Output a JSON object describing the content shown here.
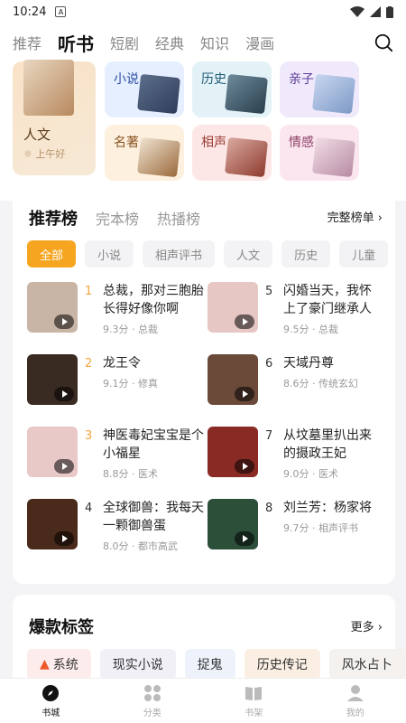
{
  "status": {
    "time": "10:24"
  },
  "topnav": {
    "tabs": [
      "推荐",
      "听书",
      "短剧",
      "经典",
      "知识",
      "漫画"
    ]
  },
  "feature": {
    "title": "人文",
    "subtitle": "上午好"
  },
  "categories": [
    {
      "label": "小说"
    },
    {
      "label": "历史"
    },
    {
      "label": "亲子"
    },
    {
      "label": "名著"
    },
    {
      "label": "相声"
    },
    {
      "label": "情感"
    }
  ],
  "ranking": {
    "tabs": [
      "推荐榜",
      "完本榜",
      "热播榜"
    ],
    "full_link": "完整榜单 ›",
    "filters": [
      "全部",
      "小说",
      "相声评书",
      "人文",
      "历史",
      "儿童"
    ],
    "items": [
      {
        "rank": "1",
        "title": "总裁，那对三胞胎长得好像你啊",
        "meta": "9.3分 · 总裁",
        "cover": "#c9b5a6"
      },
      {
        "rank": "5",
        "title": "闪婚当天，我怀上了豪门继承人",
        "meta": "9.5分 · 总裁",
        "cover": "#e7c7c4"
      },
      {
        "rank": "2",
        "title": "龙王令",
        "meta": "9.1分 · 修真",
        "cover": "#3a2b22"
      },
      {
        "rank": "6",
        "title": "天域丹尊",
        "meta": "8.6分 · 传统玄幻",
        "cover": "#6b4a3a"
      },
      {
        "rank": "3",
        "title": "神医毒妃宝宝是个小福星",
        "meta": "8.8分 · 医术",
        "cover": "#e9c9c7"
      },
      {
        "rank": "7",
        "title": "从坟墓里扒出来的摄政王妃",
        "meta": "9.0分 · 医术",
        "cover": "#8a2a24"
      },
      {
        "rank": "4",
        "title": "全球御兽：我每天一颗御兽蛋",
        "meta": "8.0分 · 都市高武",
        "cover": "#4a2a1a"
      },
      {
        "rank": "8",
        "title": "刘兰芳：杨家将",
        "meta": "9.7分 · 相声评书",
        "cover": "#2c4f3a"
      }
    ]
  },
  "hot_tags": {
    "title": "爆款标签",
    "more": "更多 ›",
    "tags": [
      "系统",
      "现实小说",
      "捉鬼",
      "历史传记",
      "风水占卜"
    ]
  },
  "bottom_nav": [
    "书城",
    "分类",
    "书架",
    "我的"
  ]
}
